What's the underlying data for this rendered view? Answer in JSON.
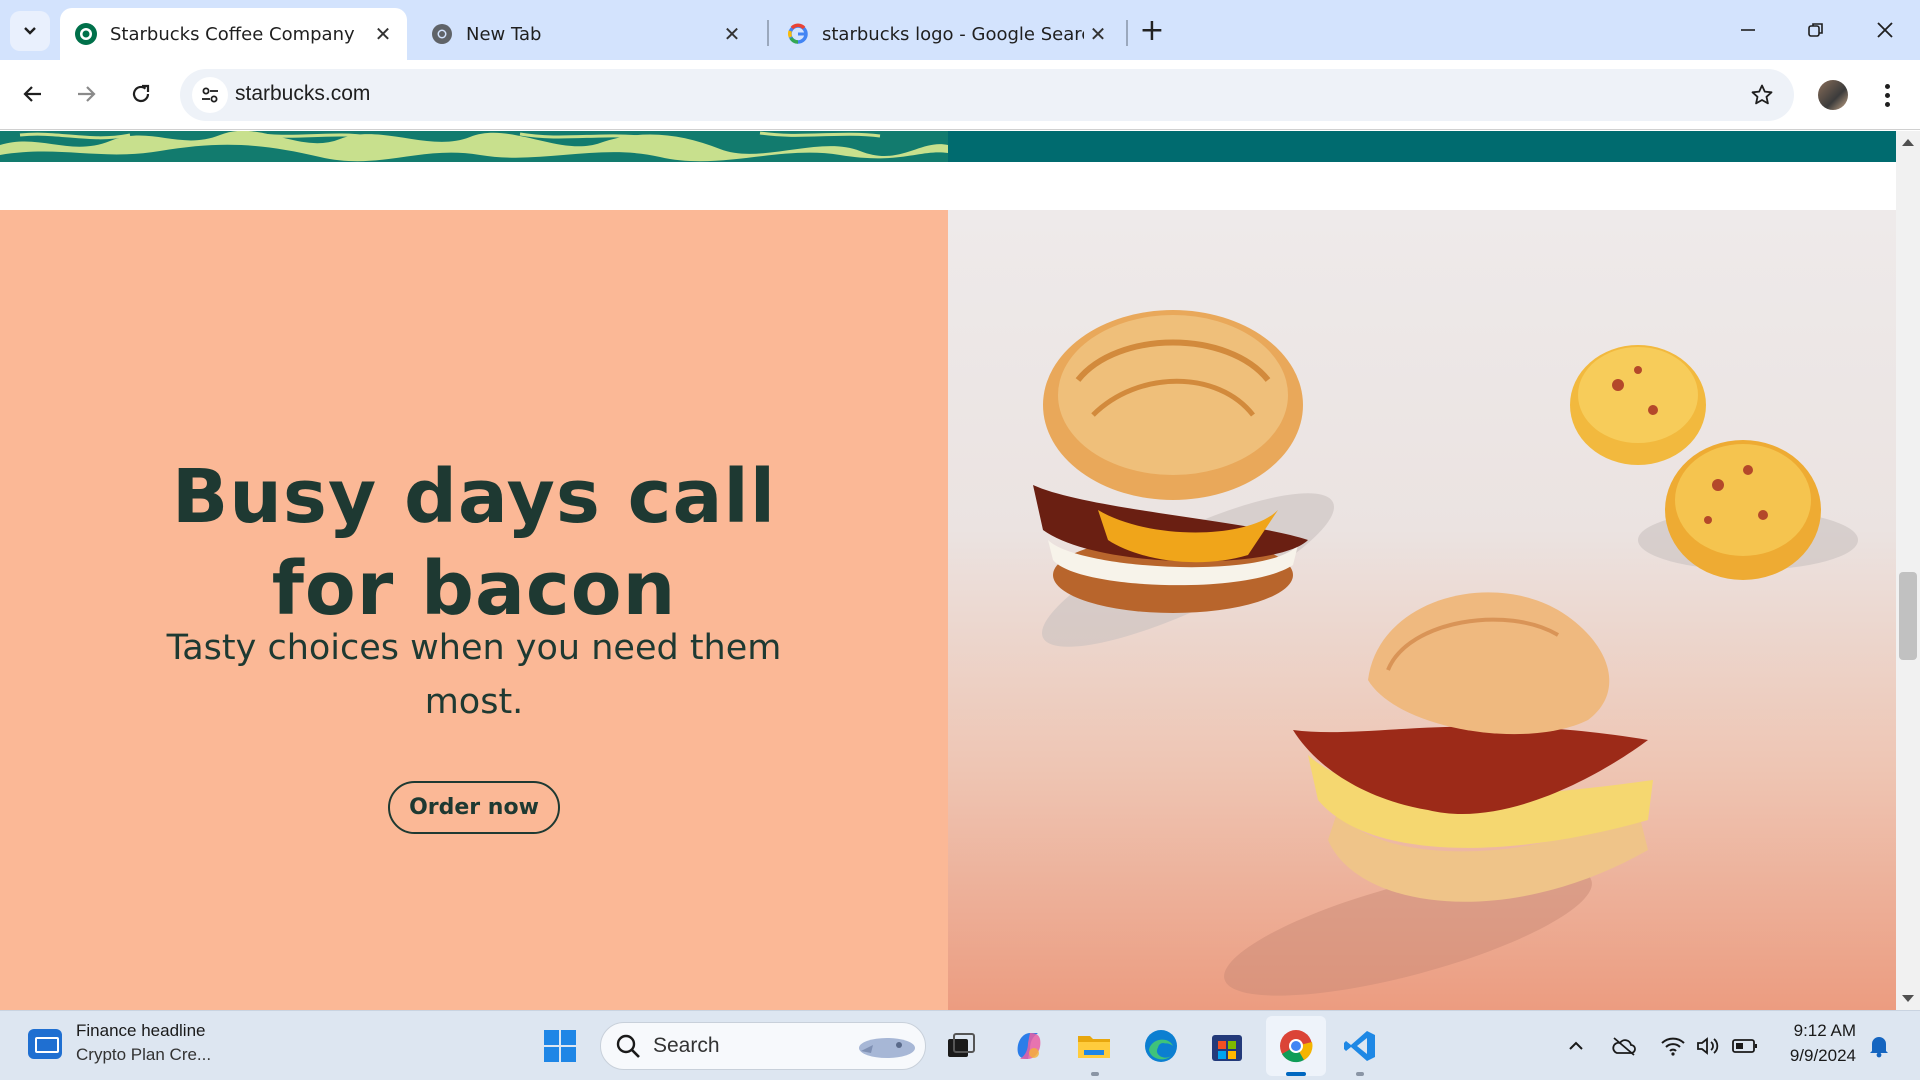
{
  "browser": {
    "tabs": [
      {
        "title": "Starbucks Coffee Company",
        "active": true,
        "favicon": "starbucks-siren-icon"
      },
      {
        "title": "New Tab",
        "active": false,
        "favicon": "chrome-icon"
      },
      {
        "title": "starbucks logo - Google Search",
        "active": false,
        "favicon": "google-g-icon"
      }
    ],
    "url": "starbucks.com"
  },
  "page": {
    "headline": "Busy days call for bacon",
    "subtitle": "Tasty choices when you need them most.",
    "cta_label": "Order now",
    "colors": {
      "hero_bg": "#fbb896",
      "text": "#1e3932",
      "banner": "#006b6f"
    }
  },
  "taskbar": {
    "news_title": "Finance headline",
    "news_subtitle": "Crypto Plan Cre...",
    "search_placeholder": "Search",
    "time": "9:12 AM",
    "date": "9/9/2024"
  }
}
